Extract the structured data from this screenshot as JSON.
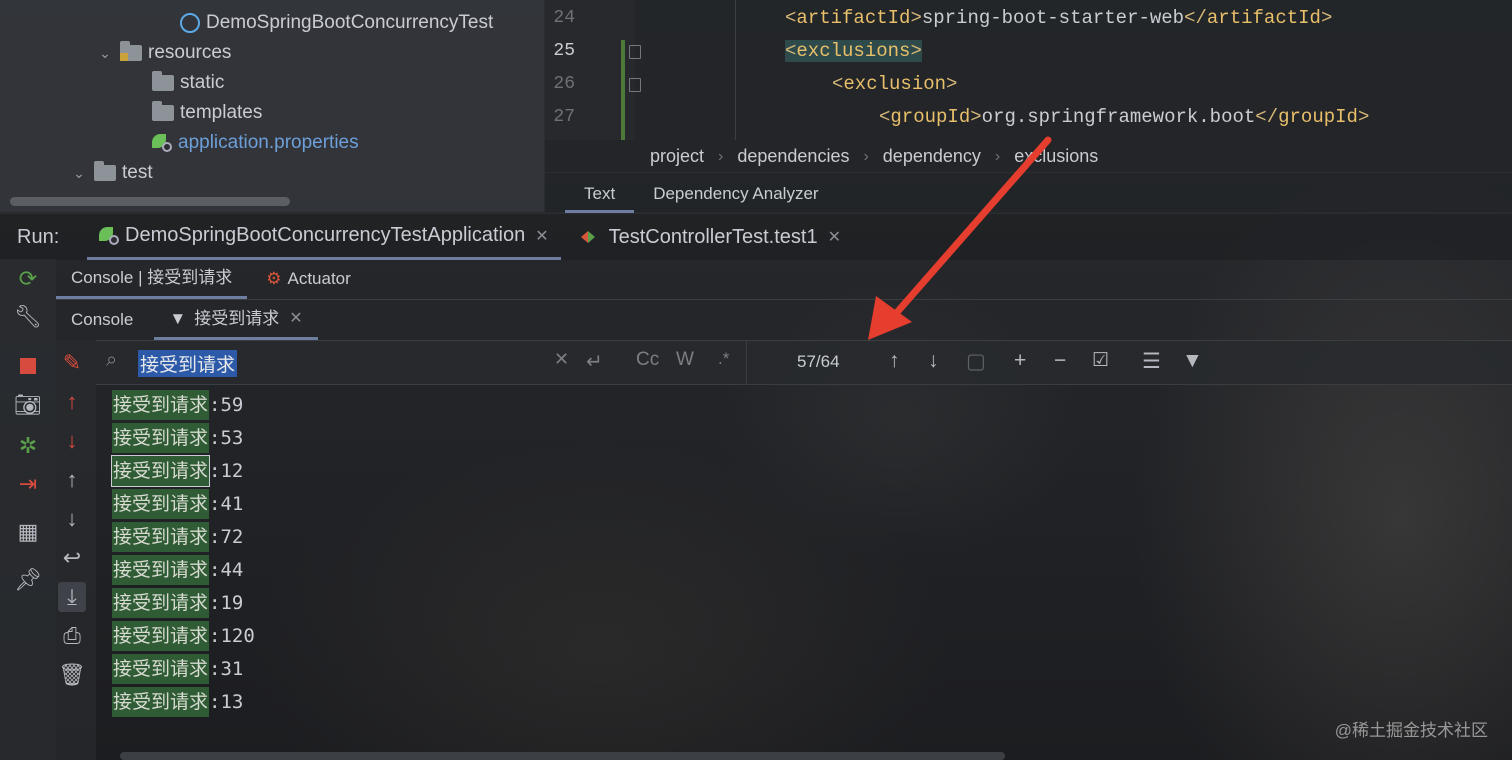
{
  "project_tree": {
    "items": [
      {
        "label": "DemoSpringBootConcurrencyTest",
        "kind": "spring-class"
      },
      {
        "label": "resources",
        "kind": "folder-expanded"
      },
      {
        "label": "static",
        "kind": "folder"
      },
      {
        "label": "templates",
        "kind": "folder"
      },
      {
        "label": "application.properties",
        "kind": "properties-file"
      },
      {
        "label": "test",
        "kind": "folder-expanded"
      }
    ]
  },
  "editor": {
    "line_numbers": [
      "24",
      "25",
      "26",
      "27"
    ],
    "lines": [
      {
        "open": "<",
        "tag": "artifactId",
        "close": ">",
        "text": "spring-boot-starter-web",
        "end_open": "</",
        "end_tag": "artifactId",
        "end_close": ">"
      },
      {
        "open": "<",
        "tag": "exclusions",
        "close": ">"
      },
      {
        "open": "<",
        "tag": "exclusion",
        "close": ">"
      },
      {
        "open": "<",
        "tag": "groupId",
        "close": ">",
        "text": "org.springframework.boot",
        "end_open": "</",
        "end_tag": "groupId",
        "end_close": ">"
      }
    ],
    "breadcrumb": [
      "project",
      "dependencies",
      "dependency",
      "exclusions"
    ],
    "tabs": [
      "Text",
      "Dependency Analyzer"
    ]
  },
  "run": {
    "label": "Run:",
    "tabs": [
      {
        "label": "DemoSpringBootConcurrencyTestApplication",
        "active": true
      },
      {
        "label": "TestControllerTest.test1",
        "active": false
      }
    ]
  },
  "console_tabs": {
    "top": [
      "Console | 接受到请求",
      "Actuator"
    ],
    "second": [
      "Console",
      "接受到请求"
    ]
  },
  "search": {
    "query": "接受到请求",
    "match_count": "57/64",
    "toggle_case": "Cc",
    "toggle_words": "W",
    "toggle_regex": ".*"
  },
  "console_output": {
    "prefix": "接受到请求",
    "separator": ": ",
    "values": [
      "59",
      "53",
      "12",
      "41",
      "72",
      "44",
      "19",
      "120",
      "31",
      "13"
    ],
    "current_match_index": 2
  },
  "watermark": "@稀土掘金技术社区",
  "colors": {
    "accent_tab": "#6e7ea0",
    "match_highlight": "#2f5b35",
    "search_selection": "#2d5aa8",
    "annotation_arrow": "#e53d2e",
    "xml_tag": "#e8bf6a"
  }
}
